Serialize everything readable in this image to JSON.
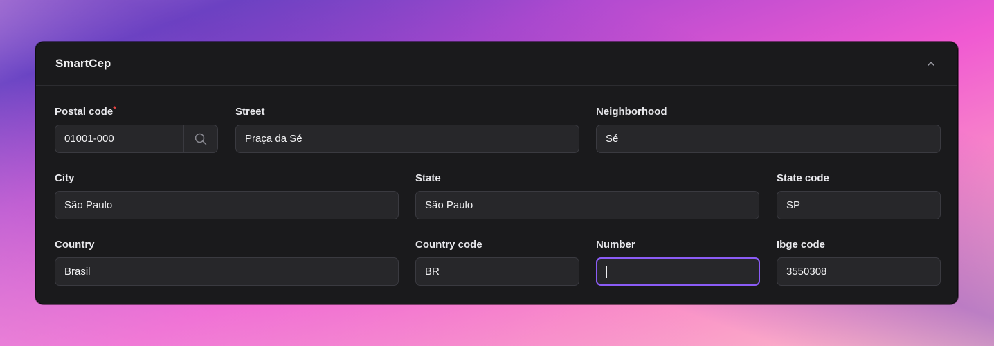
{
  "panel": {
    "title": "SmartCep",
    "collapse_icon": "chevron-up-icon"
  },
  "fields": {
    "postal_code": {
      "label": "Postal code",
      "required_mark": "*",
      "value": "01001-000",
      "search_icon": "search-icon"
    },
    "street": {
      "label": "Street",
      "value": "Praça da Sé"
    },
    "neighborhood": {
      "label": "Neighborhood",
      "value": "Sé"
    },
    "city": {
      "label": "City",
      "value": "São Paulo"
    },
    "state": {
      "label": "State",
      "value": "São Paulo"
    },
    "state_code": {
      "label": "State code",
      "value": "SP"
    },
    "country": {
      "label": "Country",
      "value": "Brasil"
    },
    "country_code": {
      "label": "Country code",
      "value": "BR"
    },
    "number": {
      "label": "Number",
      "value": ""
    },
    "ibge_code": {
      "label": "Ibge code",
      "value": "3550308"
    }
  },
  "colors": {
    "card_bg": "#1a1a1c",
    "input_bg": "#27272a",
    "focus_ring": "#8b5cf6",
    "required": "#ef4444"
  }
}
